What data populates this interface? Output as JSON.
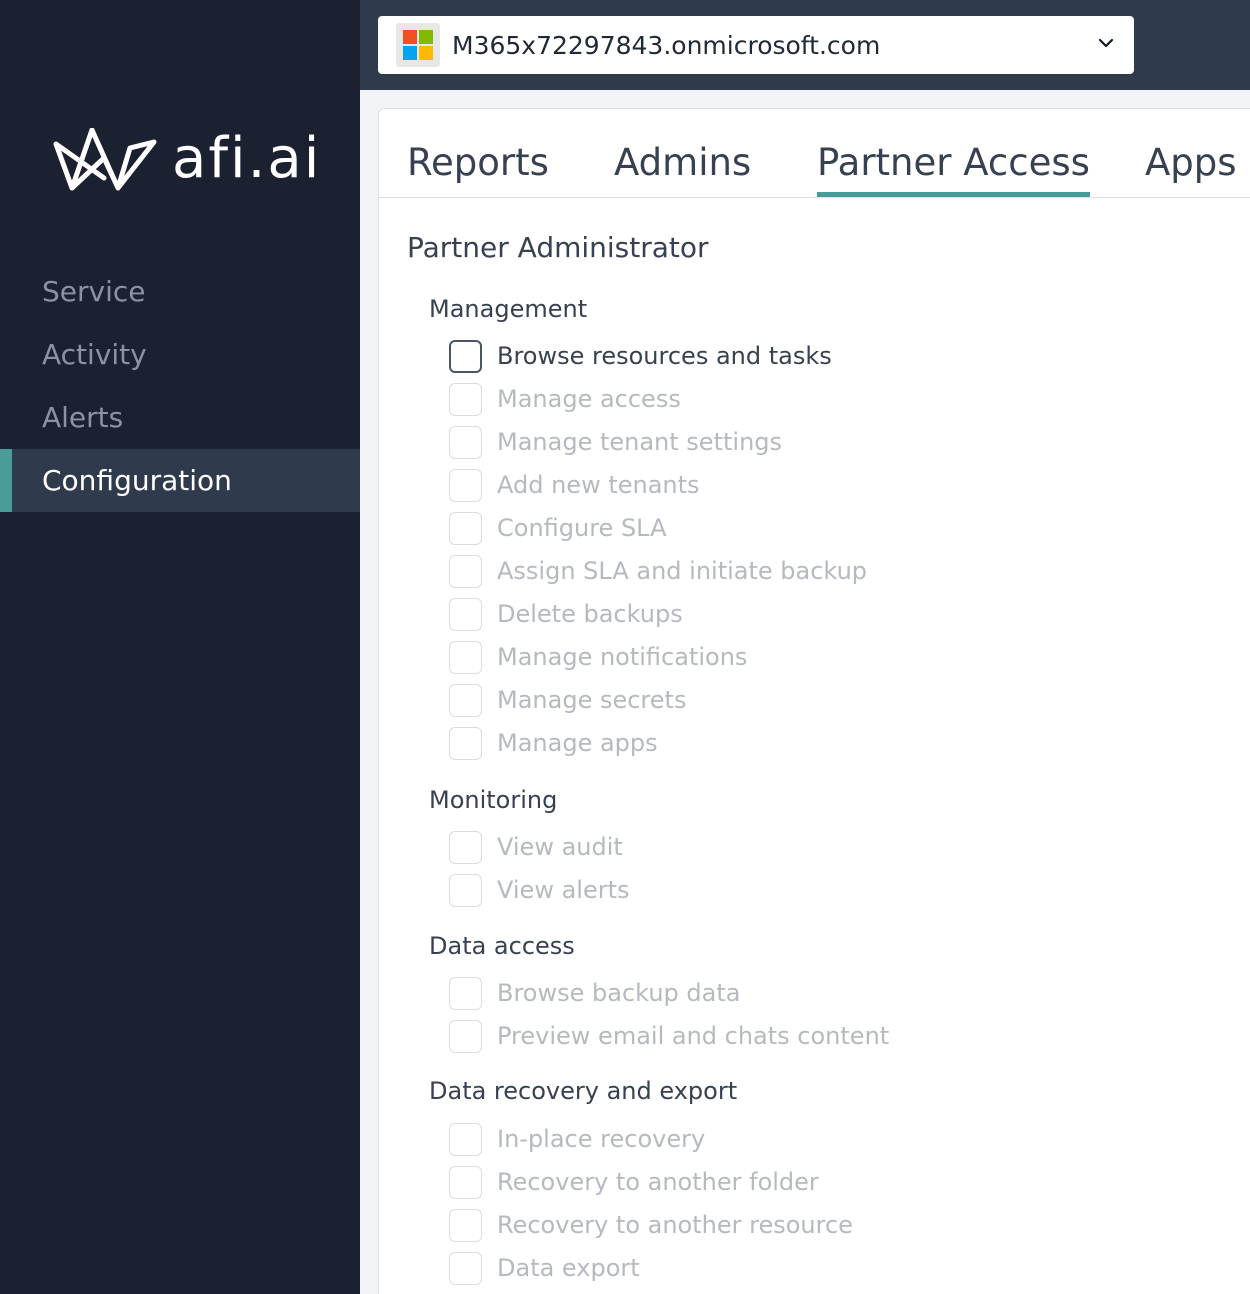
{
  "brand": {
    "name": "afi.ai"
  },
  "sidebar": {
    "items": [
      {
        "label": "Service",
        "active": false
      },
      {
        "label": "Activity",
        "active": false
      },
      {
        "label": "Alerts",
        "active": false
      },
      {
        "label": "Configuration",
        "active": true
      }
    ]
  },
  "header": {
    "tenant": "M365x72297843.onmicrosoft.com",
    "tenant_icon": "microsoft-logo",
    "dropdown_icon": "chevron-down-icon"
  },
  "tabs": [
    {
      "label": "Reports",
      "active": false
    },
    {
      "label": "Admins",
      "active": false
    },
    {
      "label": "Partner Access",
      "active": true
    },
    {
      "label": "Apps",
      "active": false
    }
  ],
  "colors": {
    "sidebar_bg": "#1b2130",
    "topbar_bg": "#2f3b4d",
    "accent": "#4a9c9b"
  },
  "section": {
    "title": "Partner Administrator",
    "groups": [
      {
        "title": "Management",
        "permissions": [
          {
            "label": "Browse resources and tasks",
            "checked": false,
            "enabled": true
          },
          {
            "label": "Manage access",
            "checked": false,
            "enabled": false
          },
          {
            "label": "Manage tenant settings",
            "checked": false,
            "enabled": false
          },
          {
            "label": "Add new tenants",
            "checked": false,
            "enabled": false
          },
          {
            "label": "Configure SLA",
            "checked": false,
            "enabled": false
          },
          {
            "label": "Assign SLA and initiate backup",
            "checked": false,
            "enabled": false
          },
          {
            "label": "Delete backups",
            "checked": false,
            "enabled": false
          },
          {
            "label": "Manage notifications",
            "checked": false,
            "enabled": false
          },
          {
            "label": "Manage secrets",
            "checked": false,
            "enabled": false
          },
          {
            "label": "Manage apps",
            "checked": false,
            "enabled": false
          }
        ]
      },
      {
        "title": "Monitoring",
        "permissions": [
          {
            "label": "View audit",
            "checked": false,
            "enabled": false
          },
          {
            "label": "View alerts",
            "checked": false,
            "enabled": false
          }
        ]
      },
      {
        "title": "Data access",
        "permissions": [
          {
            "label": "Browse backup data",
            "checked": false,
            "enabled": false
          },
          {
            "label": "Preview email and chats content",
            "checked": false,
            "enabled": false
          }
        ]
      },
      {
        "title": "Data recovery and export",
        "permissions": [
          {
            "label": "In-place recovery",
            "checked": false,
            "enabled": false
          },
          {
            "label": "Recovery to another folder",
            "checked": false,
            "enabled": false
          },
          {
            "label": "Recovery to another resource",
            "checked": false,
            "enabled": false
          },
          {
            "label": "Data export",
            "checked": false,
            "enabled": false
          }
        ]
      }
    ]
  }
}
